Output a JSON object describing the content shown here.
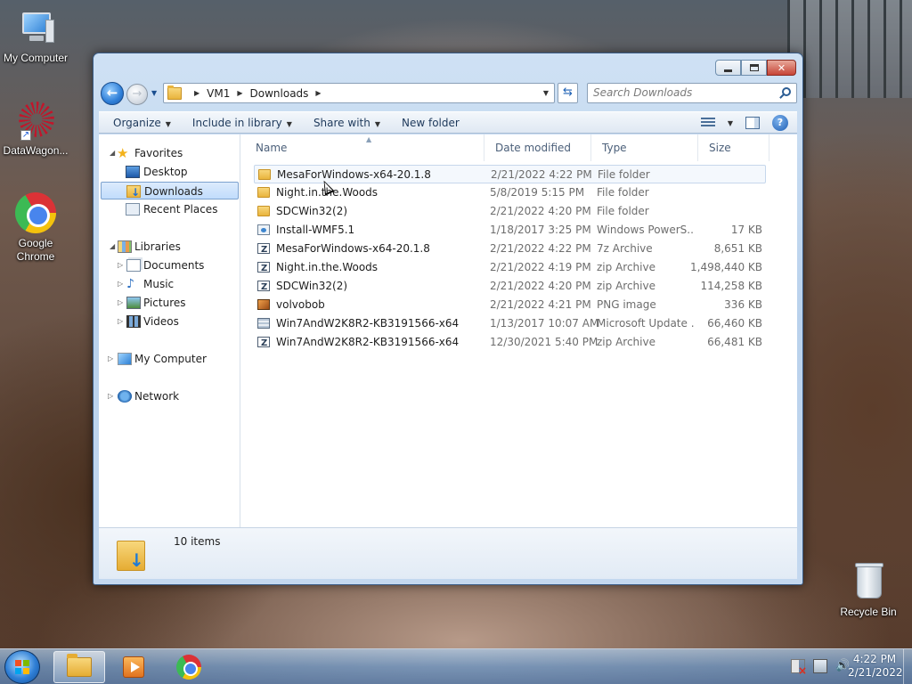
{
  "desktop": {
    "icons": [
      {
        "label": "My Computer",
        "icon": "computer-icon"
      },
      {
        "label": "DataWagon...",
        "icon": "datawagon-icon"
      },
      {
        "label": "Google Chrome",
        "icon": "chrome-icon"
      },
      {
        "label": "Recycle Bin",
        "icon": "recycle-bin-icon"
      }
    ]
  },
  "window": {
    "breadcrumb": [
      "VM1",
      "Downloads"
    ],
    "search_placeholder": "Search Downloads",
    "commands": [
      "Organize",
      "Include in library",
      "Share with",
      "New folder"
    ],
    "nav": {
      "favorites_label": "Favorites",
      "favorites": [
        "Desktop",
        "Downloads",
        "Recent Places"
      ],
      "libraries_label": "Libraries",
      "libraries": [
        "Documents",
        "Music",
        "Pictures",
        "Videos"
      ],
      "computer_label": "My Computer",
      "network_label": "Network",
      "selected": "Downloads"
    },
    "columns": [
      "Name",
      "Date modified",
      "Type",
      "Size"
    ],
    "files": [
      {
        "name": "MesaForWindows-x64-20.1.8",
        "date": "2/21/2022 4:22 PM",
        "type": "File folder",
        "size": "",
        "icon": "folder-icon"
      },
      {
        "name": "Night.in.the.Woods",
        "date": "5/8/2019 5:15 PM",
        "type": "File folder",
        "size": "",
        "icon": "folder-icon"
      },
      {
        "name": "SDCWin32(2)",
        "date": "2/21/2022 4:20 PM",
        "type": "File folder",
        "size": "",
        "icon": "folder-icon"
      },
      {
        "name": "Install-WMF5.1",
        "date": "1/18/2017 3:25 PM",
        "type": "Windows PowerS...",
        "size": "17 KB",
        "icon": "powershell-file-icon"
      },
      {
        "name": "MesaForWindows-x64-20.1.8",
        "date": "2/21/2022 4:22 PM",
        "type": "7z Archive",
        "size": "8,651 KB",
        "icon": "archive-icon"
      },
      {
        "name": "Night.in.the.Woods",
        "date": "2/21/2022 4:19 PM",
        "type": "zip Archive",
        "size": "1,498,440 KB",
        "icon": "archive-icon"
      },
      {
        "name": "SDCWin32(2)",
        "date": "2/21/2022 4:20 PM",
        "type": "zip Archive",
        "size": "114,258 KB",
        "icon": "archive-icon"
      },
      {
        "name": "volvobob",
        "date": "2/21/2022 4:21 PM",
        "type": "PNG image",
        "size": "336 KB",
        "icon": "png-image-icon"
      },
      {
        "name": "Win7AndW2K8R2-KB3191566-x64",
        "date": "1/13/2017 10:07 AM",
        "type": "Microsoft Update ...",
        "size": "66,460 KB",
        "icon": "update-package-icon"
      },
      {
        "name": "Win7AndW2K8R2-KB3191566-x64",
        "date": "12/30/2021 5:40 PM",
        "type": "zip Archive",
        "size": "66,481 KB",
        "icon": "archive-icon"
      }
    ],
    "item_count": "10 items"
  },
  "taskbar": {
    "clock_time": "4:22 PM",
    "clock_date": "2/21/2022"
  }
}
